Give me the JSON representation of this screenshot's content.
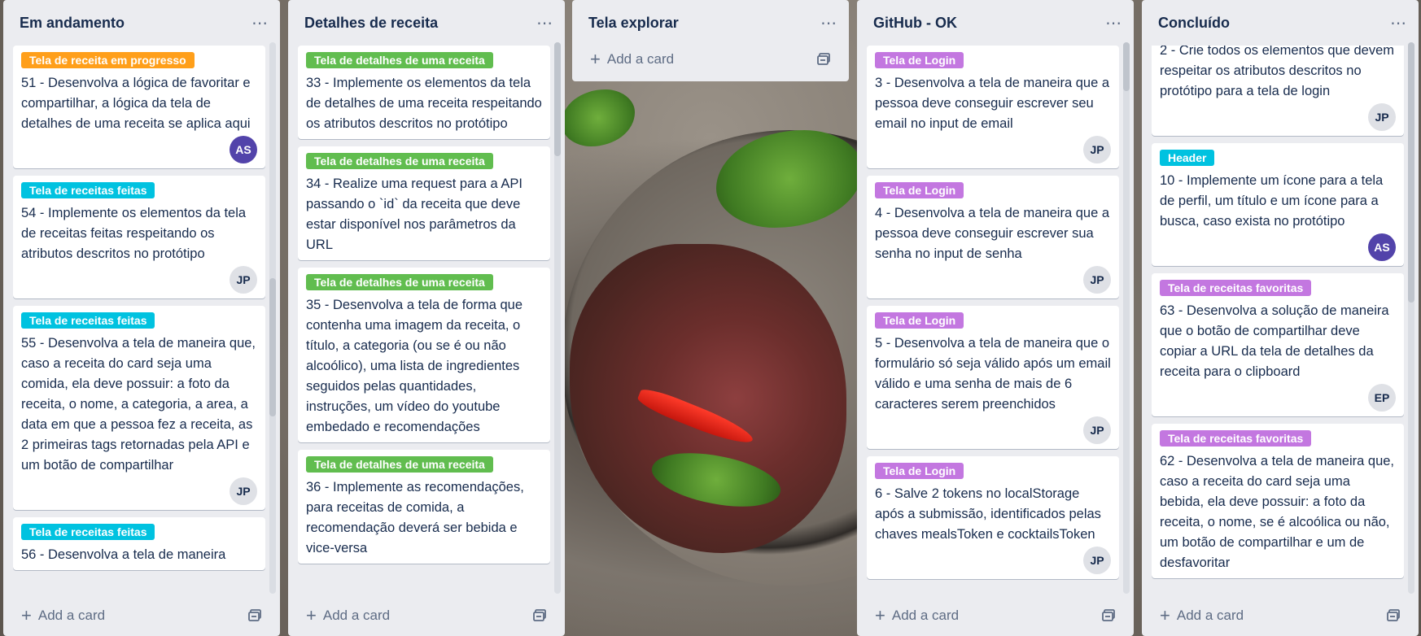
{
  "lists": [
    {
      "title": "Em andamento",
      "add_label": "Add a card",
      "cards": [
        {
          "label": "Tela de receita em progresso",
          "label_color": "orange",
          "text": "51 - Desenvolva a lógica de favoritar e compartilhar, a lógica da tela de detalhes de uma receita se aplica aqui",
          "avatar": "AS"
        },
        {
          "label": "Tela de receitas feitas",
          "label_color": "cyan",
          "text": "54 - Implemente os elementos da tela de receitas feitas respeitando os atributos descritos no protótipo",
          "avatar": "JP"
        },
        {
          "label": "Tela de receitas feitas",
          "label_color": "cyan",
          "text": "55 - Desenvolva a tela de maneira que, caso a receita do card seja uma comida, ela deve possuir: a foto da receita, o nome, a categoria, a area, a data em que a pessoa fez a receita, as 2 primeiras tags retornadas pela API e um botão de compartilhar",
          "avatar": "JP"
        },
        {
          "label": "Tela de receitas feitas",
          "label_color": "cyan",
          "text": "56 - Desenvolva a tela de maneira",
          "avatar": ""
        }
      ]
    },
    {
      "title": "Detalhes de receita",
      "add_label": "Add a card",
      "cards": [
        {
          "label": "Tela de detalhes de uma receita",
          "label_color": "green",
          "text": "33 - Implemente os elementos da tela de detalhes de uma receita respeitando os atributos descritos no protótipo",
          "avatar": ""
        },
        {
          "label": "Tela de detalhes de uma receita",
          "label_color": "green",
          "text": "34 - Realize uma request para a API passando o `id` da receita que deve estar disponível nos parâmetros da URL",
          "avatar": ""
        },
        {
          "label": "Tela de detalhes de uma receita",
          "label_color": "green",
          "text": "35 - Desenvolva a tela de forma que contenha uma imagem da receita, o título, a categoria (ou se é ou não alcoólico), uma lista de ingredientes seguidos pelas quantidades, instruções, um vídeo do youtube embedado e recomendações",
          "avatar": ""
        },
        {
          "label": "Tela de detalhes de uma receita",
          "label_color": "green",
          "text": "36 - Implemente as recomendações, para receitas de comida, a recomendação deverá ser bebida e vice-versa",
          "avatar": ""
        }
      ]
    },
    {
      "title": "Tela explorar",
      "add_label": "Add a card",
      "cards": []
    },
    {
      "title": "GitHub - OK",
      "add_label": "Add a card",
      "cards": [
        {
          "label": "Tela de Login",
          "label_color": "purple",
          "text": "3 - Desenvolva a tela de maneira que a pessoa deve conseguir escrever seu email no input de email",
          "avatar": "JP"
        },
        {
          "label": "Tela de Login",
          "label_color": "purple",
          "text": "4 - Desenvolva a tela de maneira que a pessoa deve conseguir escrever sua senha no input de senha",
          "avatar": "JP"
        },
        {
          "label": "Tela de Login",
          "label_color": "purple",
          "text": "5 - Desenvolva a tela de maneira que o formulário só seja válido após um email válido e uma senha de mais de 6 caracteres serem preenchidos",
          "avatar": "JP"
        },
        {
          "label": "Tela de Login",
          "label_color": "purple",
          "text": "6 - Salve 2 tokens no localStorage após a submissão, identificados pelas chaves mealsToken e cocktailsToken",
          "avatar": "JP"
        }
      ]
    },
    {
      "title": "Concluído",
      "add_label": "Add a card",
      "cards": [
        {
          "label": "",
          "label_color": "",
          "text": "2 - Crie todos os elementos que devem respeitar os atributos descritos no protótipo para a tela de login",
          "avatar": "JP"
        },
        {
          "label": "Header",
          "label_color": "cyan",
          "text": "10 - Implemente um ícone para a tela de perfil, um título e um ícone para a busca, caso exista no protótipo",
          "avatar": "AS"
        },
        {
          "label": "Tela de receitas favoritas",
          "label_color": "purple",
          "text": "63 - Desenvolva a solução de maneira que o botão de compartilhar deve copiar a URL da tela de detalhes da receita para o clipboard",
          "avatar": "EP"
        },
        {
          "label": "Tela de receitas favoritas",
          "label_color": "purple",
          "text": "62 - Desenvolva a tela de maneira que, caso a receita do card seja uma bebida, ela deve possuir: a foto da receita, o nome, se é alcoólica ou não, um botão de compartilhar e um de desfavoritar",
          "avatar": ""
        }
      ]
    }
  ]
}
